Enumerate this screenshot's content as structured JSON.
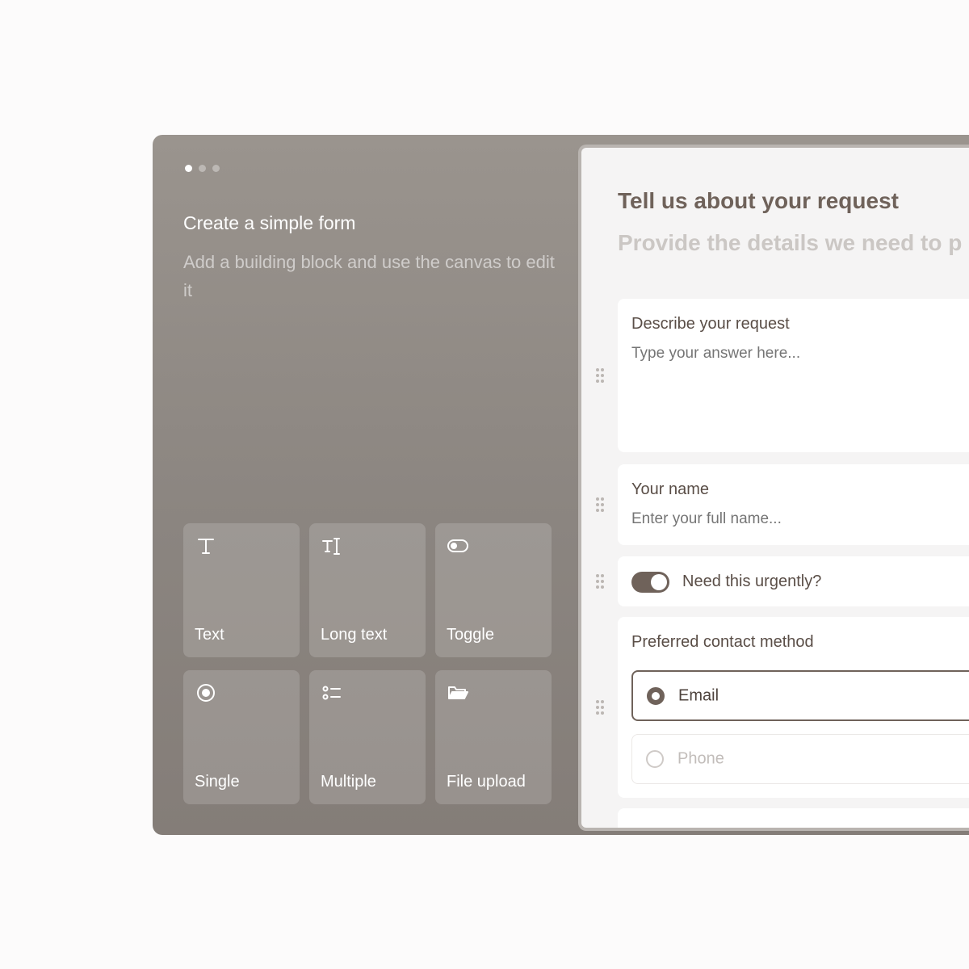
{
  "carousel": {
    "dots": 3,
    "active_index": 0
  },
  "intro": {
    "title": "Create a simple form",
    "subtitle": "Add a building block and use the canvas to edit it"
  },
  "blocks": [
    {
      "label": "Text",
      "icon": "text-icon"
    },
    {
      "label": "Long text",
      "icon": "long-text-icon"
    },
    {
      "label": "Toggle",
      "icon": "toggle-icon"
    },
    {
      "label": "Single",
      "icon": "radio-icon"
    },
    {
      "label": "Multiple",
      "icon": "list-icon"
    },
    {
      "label": "File upload",
      "icon": "folder-icon"
    }
  ],
  "form": {
    "title": "Tell us about your request",
    "subtitle": "Provide the details we need to p",
    "fields": {
      "request": {
        "label": "Describe your request",
        "placeholder": "Type your answer here..."
      },
      "name": {
        "label": "Your name",
        "placeholder": "Enter your full name..."
      },
      "urgent": {
        "label": "Need this urgently?",
        "on": true
      },
      "contact": {
        "label": "Preferred contact method",
        "options": [
          {
            "label": "Email",
            "selected": true
          },
          {
            "label": "Phone",
            "selected": false
          }
        ]
      }
    }
  },
  "colors": {
    "accent": "#6f625a",
    "panel": "#8b8580",
    "canvas": "#f5f4f4"
  }
}
